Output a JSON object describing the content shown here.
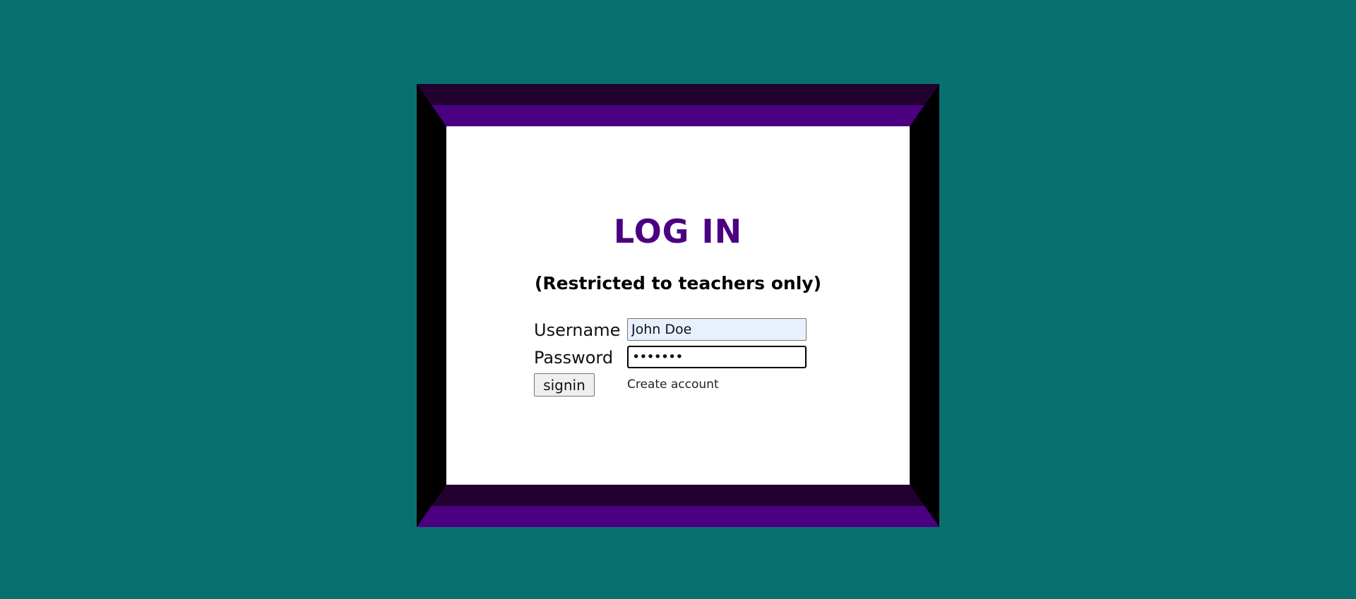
{
  "login": {
    "title": "LOG IN",
    "subtitle": "(Restricted to teachers only)",
    "username_label": "Username",
    "username_value": "John Doe",
    "password_label": "Password",
    "password_value": "•••••••",
    "signin_label": "signin",
    "create_account_label": "Create account"
  },
  "colors": {
    "background": "#08716f",
    "frame_purple": "#4b0082",
    "frame_dark": "#22002f",
    "frame_side": "#000000",
    "title": "#4b0082"
  }
}
